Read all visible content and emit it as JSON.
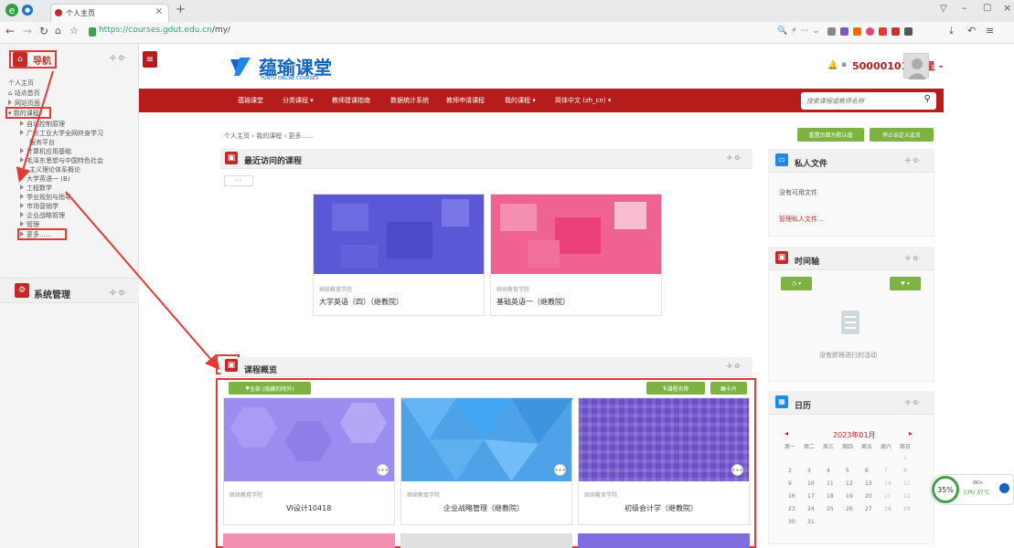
{
  "browser": {
    "tab_title": "个人主页",
    "url_scheme": "https://",
    "url_host": "courses.gdut.edu.cn",
    "url_path": "/my/"
  },
  "nav": {
    "title": "导航",
    "items": [
      "个人主页",
      "站点首页",
      "网站页面",
      "我的课程"
    ],
    "courses": [
      "自动控制原理",
      "广东工业大学全网终身学习",
      "服务平台",
      "计算机应用基础",
      "毛泽东思想与中国特色社会",
      "主义理论体系概论",
      "大学英语一 (B)",
      "工程数学",
      "学业规划与指导",
      "市场营销学",
      "企业战略管理",
      "管理"
    ],
    "more": "更多......",
    "admin_title": "系统管理"
  },
  "site": {
    "logo_text": "蕴瑜课堂",
    "logo_sub": "YUNYU ONLINE COURSES",
    "user_name": "500001010胡星 -"
  },
  "menu": {
    "items": [
      "蕴瑜课堂",
      "分类课程 ▾",
      "教师建课指南",
      "数据统计系统",
      "教师申请课程",
      "我的课程 ▾",
      "简体中文 (zh_cn) ▾"
    ],
    "search_placeholder": "搜索课程或教师名称"
  },
  "breadcrumb": "个人主页 › 我的课程 › 更多......",
  "buttons": {
    "reset": "重置页面为默认值",
    "stop_custom": "停止自定义此页"
  },
  "recent": {
    "title": "最近访问的课程",
    "courses": [
      {
        "category": "继续教育学院",
        "name": "大学英语（四）（继教院）",
        "color": "#5b57d6"
      },
      {
        "category": "继续教育学院",
        "name": "基础英语一（继教院）",
        "color": "#f06292"
      }
    ]
  },
  "overview": {
    "title": "课程概览",
    "filter": "全部 (隐藏的除外)",
    "sort": "课程名称",
    "view": "卡片",
    "courses": [
      {
        "category": "继续教育学院",
        "name": "VI设计10418",
        "color": "#9b8cf0"
      },
      {
        "category": "继续教育学院",
        "name": "企业战略管理（继教院）",
        "color": "#4ea3e8"
      },
      {
        "category": "继续教育学院",
        "name": "初级会计学（继教院）",
        "color": "#6a4fc8"
      }
    ]
  },
  "private_files": {
    "title": "私人文件",
    "empty": "没有可用文件",
    "manage": "管理私人文件..."
  },
  "timeline": {
    "title": "时间轴",
    "empty": "没有即将进行的活动"
  },
  "calendar": {
    "title": "日历",
    "month": "2023年01月",
    "weekdays": [
      "周一",
      "周二",
      "周三",
      "周四",
      "周五",
      "周六",
      "周日"
    ],
    "weeks": [
      [
        "",
        "",
        "",
        "",
        "",
        "",
        "1"
      ],
      [
        "2",
        "3",
        "4",
        "5",
        "6",
        "7",
        "8"
      ],
      [
        "9",
        "10",
        "11",
        "12",
        "13",
        "14",
        "15"
      ],
      [
        "16",
        "17",
        "18",
        "19",
        "20",
        "21",
        "22"
      ],
      [
        "23",
        "24",
        "25",
        "26",
        "27",
        "28",
        "29"
      ],
      [
        "30",
        "31",
        "",
        "",
        "",
        "",
        ""
      ]
    ]
  },
  "widget": {
    "cpu_pct": "35%",
    "cpu_label": "CPU 37℃",
    "net": "0K/s"
  },
  "colors": {
    "brand_red": "#b71c1c",
    "accent_green": "#7cb342",
    "annotation_red": "#e53935"
  }
}
